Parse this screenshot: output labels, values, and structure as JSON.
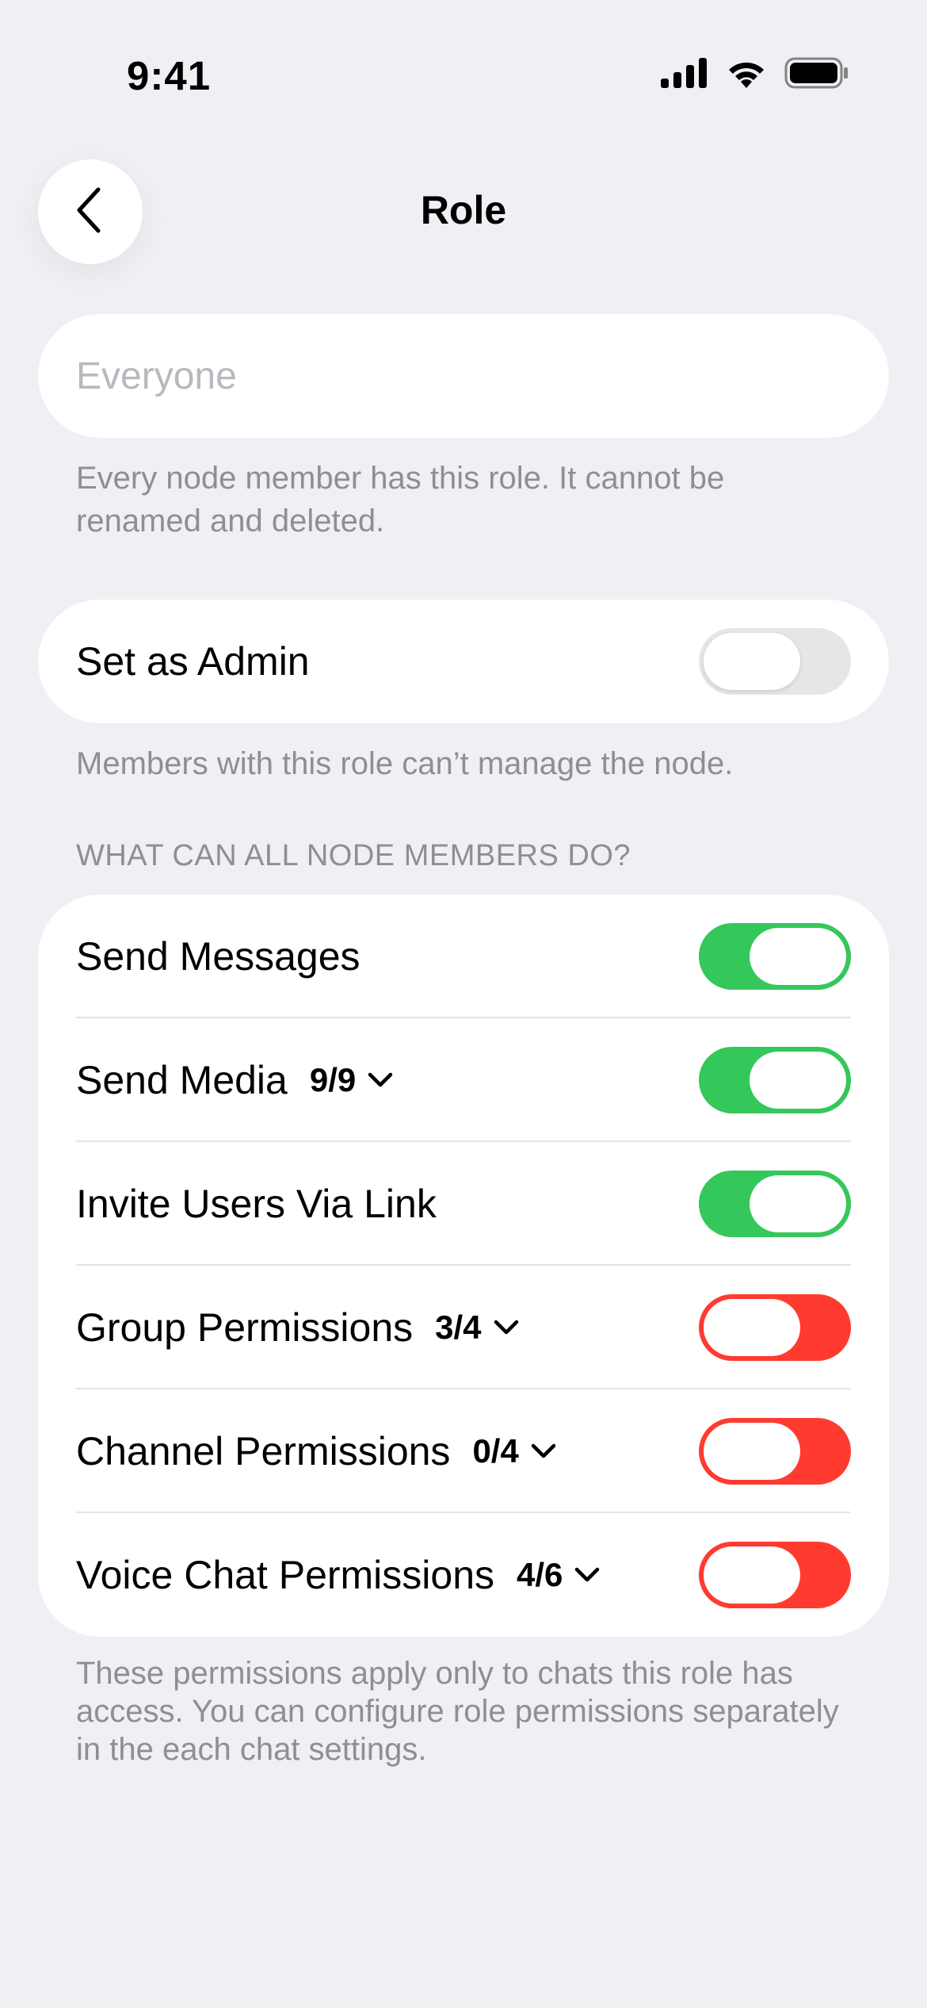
{
  "status_bar": {
    "time": "9:41",
    "icons": [
      "signal-icon",
      "wifi-icon",
      "battery-icon"
    ]
  },
  "nav": {
    "title": "Role",
    "back_icon": "chevron-left-icon"
  },
  "name_field": {
    "placeholder": "Everyone",
    "value": ""
  },
  "name_note": "Every node member has this role. It cannot be renamed and deleted.",
  "admin": {
    "label": "Set as Admin",
    "enabled": false,
    "note": "Members with this role can’t manage the node."
  },
  "permissions": {
    "header": "WHAT CAN ALL NODE MEMBERS DO?",
    "items": [
      {
        "label": "Send Messages",
        "count": "",
        "state": "on"
      },
      {
        "label": "Send Media",
        "count": "9/9",
        "state": "on"
      },
      {
        "label": "Invite Users Via Link",
        "count": "",
        "state": "on"
      },
      {
        "label": "Group Permissions",
        "count": "3/4",
        "state": "off"
      },
      {
        "label": "Channel Permissions",
        "count": "0/4",
        "state": "off"
      },
      {
        "label": "Voice Chat Permissions",
        "count": "4/6",
        "state": "off"
      }
    ],
    "note": "These permissions apply only to chats this role has access. You can configure role permissions separately in the each chat settings."
  },
  "colors": {
    "background": "#EFEFF4",
    "on": "#34C759",
    "off": "#FF3B30",
    "secondary_text": "#8E8E93"
  }
}
